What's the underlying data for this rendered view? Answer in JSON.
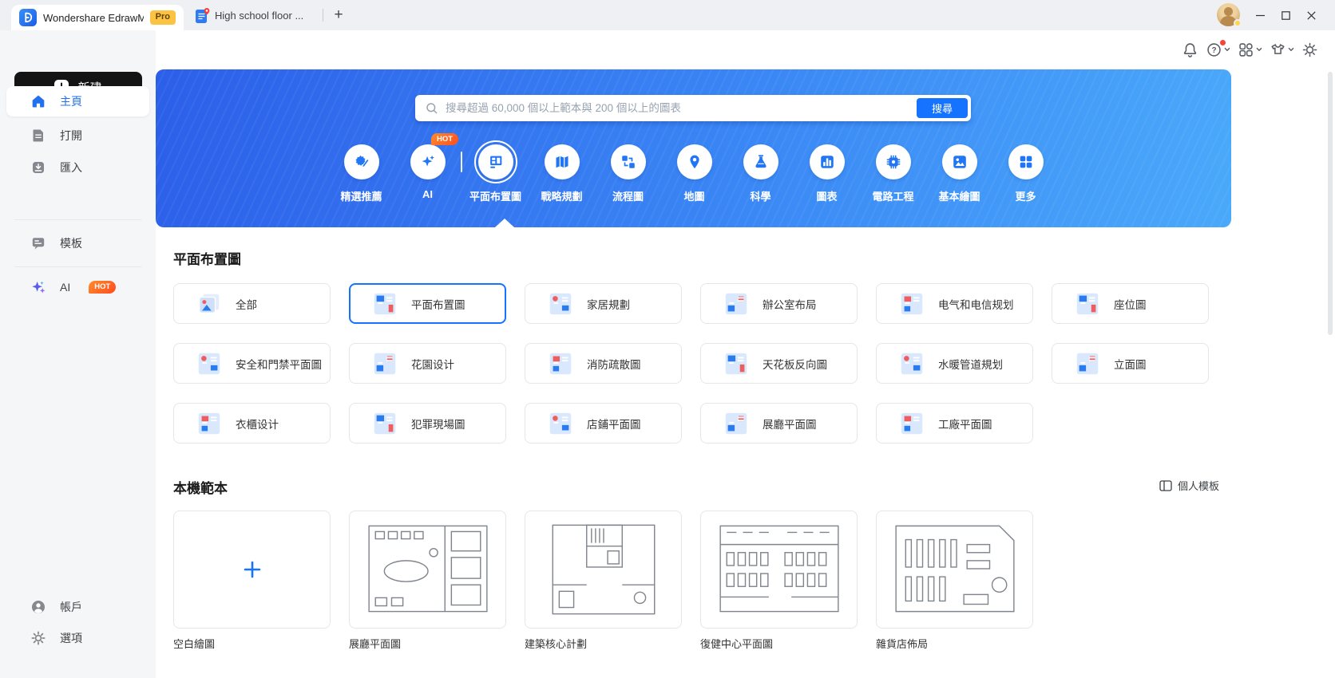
{
  "titlebar": {
    "tabs": [
      {
        "label": "Wondershare EdrawMax",
        "badge": "Pro",
        "active": true
      },
      {
        "label": "High school floor ...",
        "active": false
      }
    ],
    "new_tab_label": "+"
  },
  "topbar": {
    "icons": [
      {
        "name": "notification-bell-icon"
      },
      {
        "name": "help-icon",
        "has_alert": true
      },
      {
        "name": "apps-icon"
      },
      {
        "name": "theme-icon"
      },
      {
        "name": "settings-icon"
      }
    ]
  },
  "sidebar": {
    "new_button_label": "新建",
    "items": [
      {
        "label": "主頁",
        "active": true
      },
      {
        "label": "打開"
      },
      {
        "label": "匯入"
      },
      {
        "label": "模板"
      },
      {
        "label": "AI",
        "badge": "HOT"
      }
    ],
    "bottom_items": [
      {
        "label": "帳戶"
      },
      {
        "label": "選項"
      }
    ]
  },
  "banner": {
    "search_placeholder": "搜尋超過 60,000 個以上範本與 200 個以上的圖表",
    "search_button_label": "搜尋",
    "categories": [
      {
        "label": "精選推薦",
        "icon": "featured-icon"
      },
      {
        "label": "AI",
        "icon": "ai-sparkle-icon",
        "badge": "HOT"
      },
      {
        "label": "平面布置圖",
        "icon": "floor-plan-icon",
        "selected": true
      },
      {
        "label": "戰略規劃",
        "icon": "strategy-map-icon"
      },
      {
        "label": "流程圖",
        "icon": "flowchart-icon"
      },
      {
        "label": "地圖",
        "icon": "map-icon"
      },
      {
        "label": "科學",
        "icon": "science-flask-icon"
      },
      {
        "label": "圖表",
        "icon": "bar-chart-icon"
      },
      {
        "label": "電路工程",
        "icon": "circuit-icon"
      },
      {
        "label": "基本繪圖",
        "icon": "basic-drawing-icon"
      },
      {
        "label": "更多",
        "icon": "more-grid-icon"
      }
    ]
  },
  "main": {
    "section_title": "平面布置圖",
    "category_cards": [
      {
        "label": "全部",
        "icon": "all-templates-icon"
      },
      {
        "label": "平面布置圖",
        "icon": "floor-plan-thumb-icon",
        "selected": true
      },
      {
        "label": "家居規劃",
        "icon": "home-plan-thumb-icon"
      },
      {
        "label": "辦公室布局",
        "icon": "office-layout-thumb-icon"
      },
      {
        "label": "电气和电信规划",
        "icon": "electrical-telecom-thumb-icon"
      },
      {
        "label": "座位圖",
        "icon": "seating-chart-thumb-icon"
      },
      {
        "label": "安全和門禁平面圖",
        "icon": "security-access-thumb-icon"
      },
      {
        "label": "花園设计",
        "icon": "garden-design-thumb-icon"
      },
      {
        "label": "消防疏散圖",
        "icon": "fire-evacuation-thumb-icon"
      },
      {
        "label": "天花板反向圖",
        "icon": "ceiling-plan-thumb-icon"
      },
      {
        "label": "水暖管道規划",
        "icon": "plumbing-thumb-icon"
      },
      {
        "label": "立面圖",
        "icon": "elevation-thumb-icon"
      },
      {
        "label": "衣櫃设计",
        "icon": "wardrobe-design-thumb-icon"
      },
      {
        "label": "犯罪現場圖",
        "icon": "crime-scene-thumb-icon"
      },
      {
        "label": "店鋪平面圖",
        "icon": "store-plan-thumb-icon"
      },
      {
        "label": "展廳平面圖",
        "icon": "showroom-plan-thumb-icon"
      },
      {
        "label": "工廠平面圖",
        "icon": "factory-plan-thumb-icon"
      }
    ],
    "local_templates": {
      "title": "本機範本",
      "personal_templates_label": "個人模板",
      "items": [
        {
          "name": "空白繪圖",
          "thumbnail": "plus"
        },
        {
          "name": "展廳平面圖",
          "thumbnail": "floor-plan-1"
        },
        {
          "name": "建築核心計劃",
          "thumbnail": "floor-plan-2"
        },
        {
          "name": "復健中心平面圖",
          "thumbnail": "floor-plan-3"
        },
        {
          "name": "雜貨店佈局",
          "thumbnail": "floor-plan-4"
        }
      ]
    }
  },
  "colors": {
    "accent_blue": "#1673ff",
    "banner_gradient_start": "#2c5fe9",
    "banner_gradient_end": "#4aa9fa",
    "hot_badge_orange": "#ff5c1f",
    "pro_badge_yellow": "#fcc343",
    "sidebar_active_blue": "#2170f0"
  }
}
